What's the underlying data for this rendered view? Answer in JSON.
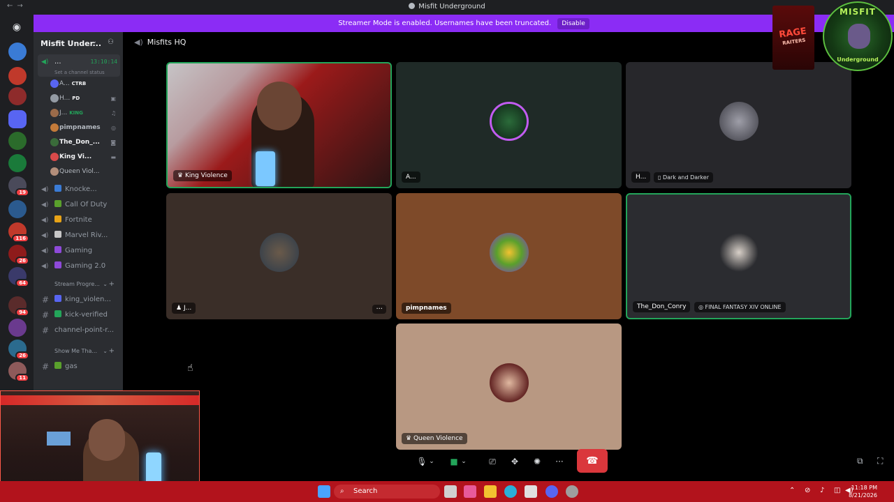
{
  "window": {
    "title": "Misfit Underground"
  },
  "banner": {
    "text": "Streamer Mode is enabled. Usernames have been truncated.",
    "button": "Disable"
  },
  "server_badges": [
    "19",
    "116",
    "26",
    "64",
    "94",
    "26",
    "11"
  ],
  "sidebar": {
    "guild_name": "Misfit Under...",
    "current_channel": {
      "name": "...",
      "time": "13:10:14",
      "status": "Set a channel status"
    },
    "members": [
      {
        "name": "A...",
        "tag": "CTRB",
        "color": "#5865f2"
      },
      {
        "name": "H...",
        "tag": "PD",
        "color": "#949ba4"
      },
      {
        "name": "J...",
        "tag": "KING",
        "color": "#9b6b4a"
      },
      {
        "name": "pimpnames",
        "tag": "",
        "color": "#c47b3a"
      },
      {
        "name": "The_Don_...",
        "tag": "",
        "color": "#3a6b3a"
      },
      {
        "name": "King Vi...",
        "tag": "",
        "color": "#d94a4a"
      },
      {
        "name": "Queen Viol...",
        "tag": "",
        "color": "#b38e7a"
      }
    ],
    "voice_channels": [
      {
        "name": "Knocke...",
        "color": "#3a7bd5"
      },
      {
        "name": "Call Of Duty",
        "color": "#5aa02c"
      },
      {
        "name": "Fortnite",
        "color": "#e8a317"
      },
      {
        "name": "Marvel Riv...",
        "color": "#c7c7c7"
      },
      {
        "name": "Gaming",
        "color": "#8e4ad9"
      },
      {
        "name": "Gaming 2.0",
        "color": "#8e4ad9"
      }
    ],
    "category_1": "Stream Progre...",
    "text_channels_1": [
      {
        "name": "king_violen...",
        "color": "#5865f2"
      },
      {
        "name": "kick-verified",
        "color": "#23a55a"
      },
      {
        "name": "channel-point-r...",
        "color": ""
      }
    ],
    "category_2": "Show Me Tha...",
    "text_channels_2": [
      {
        "name": "gas",
        "color": "#5aa02c"
      }
    ]
  },
  "main": {
    "header": "Misfits HQ",
    "tiles": [
      {
        "label": "King Violence",
        "label2": ""
      },
      {
        "label": "A...",
        "label2": ""
      },
      {
        "label": "H...",
        "label2": "Dark and Darker"
      },
      {
        "label": "J...",
        "label2": ""
      },
      {
        "label": "pimpnames",
        "label2": ""
      },
      {
        "label": "The_Don_Conry",
        "label2": "FINAL FANTASY XIV ONLINE"
      },
      {
        "label": "Queen Violence",
        "label2": ""
      }
    ]
  },
  "overlay": {
    "logo_right_top": "MISFIT",
    "logo_right_bottom": "Underground",
    "logo_left": "RAGE",
    "logo_left_sub": "RAITERS"
  },
  "taskbar": {
    "search": "Search",
    "time": "11:18 PM",
    "date": "8/21/2026"
  }
}
